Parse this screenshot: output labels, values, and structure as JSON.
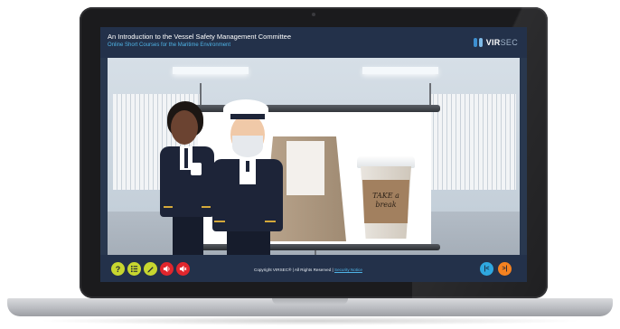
{
  "course": {
    "title": "An Introduction to the Vessel Safety Management Committee",
    "subtitle": "Online Short Courses for the Maritime Environment"
  },
  "logo": {
    "text": "VIR",
    "text_tail": "SEC",
    "icon": "virsec-logo-mark",
    "color": "#3d8fd0"
  },
  "scene": {
    "cup_text": "TAKE a break"
  },
  "toolbar": {
    "help_icon": "help-question-icon",
    "help_label": "?",
    "menu_icon": "list-menu-icon",
    "notes_icon": "pencil-icon",
    "audio_icon": "speaker-icon",
    "volume_icon": "volume-icon",
    "colors": {
      "help": "#c7d62f",
      "menu": "#c7d62f",
      "notes": "#c7d62f",
      "audio": "#e0262d",
      "volume": "#e0262d"
    }
  },
  "footer": {
    "copyright_text": "Copyright VIRSEC® | All Rights Reserved |",
    "link_text": "Security Notice"
  },
  "nav": {
    "previous_label": "|<",
    "next_label": ">|",
    "previous_color": "#2fa8e0",
    "next_color": "#f58220"
  }
}
